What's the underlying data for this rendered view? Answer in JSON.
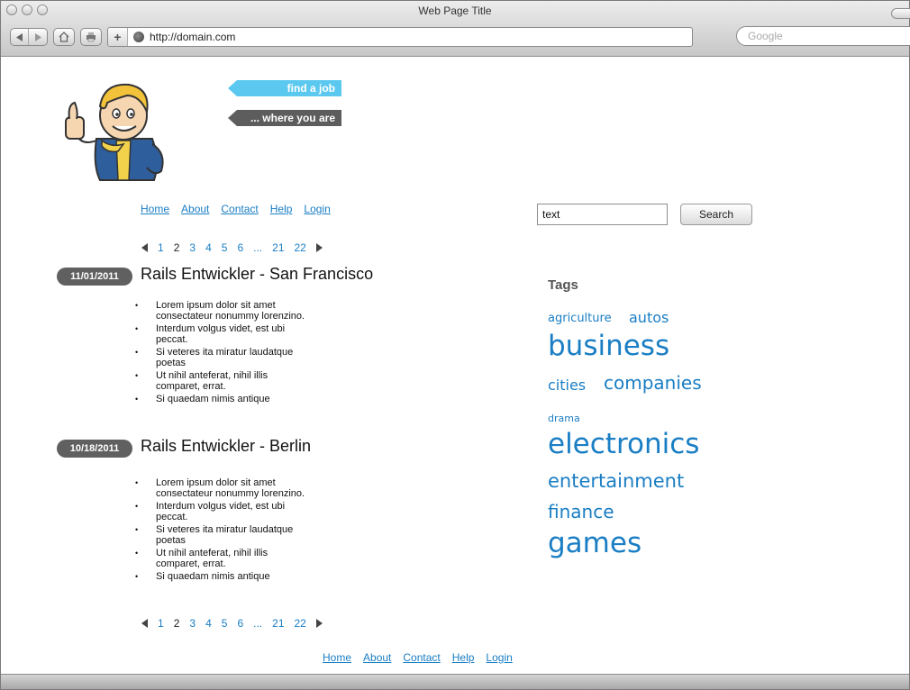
{
  "browser": {
    "window_title": "Web Page Title",
    "url": "http://domain.com",
    "search_placeholder": "Google"
  },
  "brand": {
    "banner_primary": "find a job",
    "banner_secondary": "... where you are"
  },
  "nav": {
    "items": [
      "Home",
      "About",
      "Contact",
      "Help",
      "Login"
    ]
  },
  "pagination": {
    "pages": [
      "1",
      "2",
      "3",
      "4",
      "5",
      "6",
      "...",
      "21",
      "22"
    ],
    "current": "2"
  },
  "search": {
    "value": "text",
    "button_label": "Search"
  },
  "jobs": [
    {
      "date": "11/01/2011",
      "title": "Rails Entwickler - San Francisco",
      "bullets": [
        "Lorem ipsum dolor sit amet consectateur nonummy lorenzino.",
        "Interdum volgus videt, est ubi peccat.",
        "Si veteres ita miratur laudatque poetas",
        "Ut nihil anteferat, nihil illis comparet, errat.",
        "Si quaedam nimis antique"
      ]
    },
    {
      "date": "10/18/2011",
      "title": "Rails Entwickler - Berlin",
      "bullets": [
        "Lorem ipsum dolor sit amet consectateur nonummy lorenzino.",
        "Interdum volgus videt, est ubi peccat.",
        "Si veteres ita miratur laudatque poetas",
        "Ut nihil anteferat, nihil illis comparet, errat.",
        "Si quaedam nimis antique"
      ]
    }
  ],
  "tags": {
    "heading": "Tags",
    "items": [
      "agriculture",
      "autos",
      "business",
      "cities",
      "companies",
      "drama",
      "electronics",
      "entertainment",
      "finance",
      "games"
    ]
  }
}
